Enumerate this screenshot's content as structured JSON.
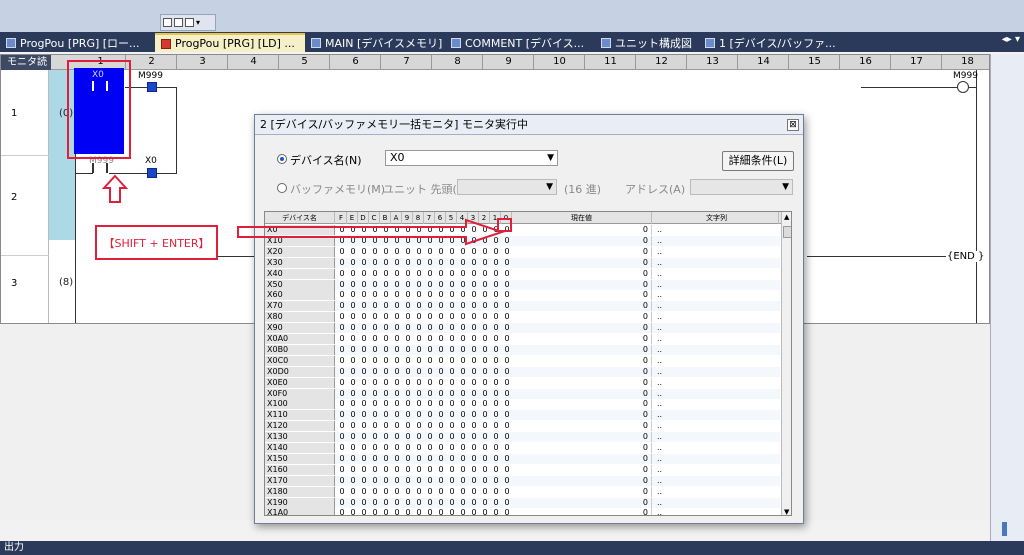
{
  "tabs": [
    {
      "label": "ProgPou [PRG] [ロー...",
      "active": false
    },
    {
      "label": "ProgPou [PRG] [LD] ...",
      "active": true
    },
    {
      "label": "MAIN [デバイスメモリ]",
      "active": false
    },
    {
      "label": "COMMENT [デバイス...",
      "active": false
    },
    {
      "label": "ユニット構成図",
      "active": false
    },
    {
      "label": "1 [デバイス/バッファ...",
      "active": false
    }
  ],
  "tab_controls": "◂▸ ▾",
  "ladder": {
    "mode_label": "モニタ読",
    "columns": [
      "1",
      "2",
      "3",
      "4",
      "5",
      "6",
      "7",
      "8",
      "9",
      "10",
      "11",
      "12",
      "13",
      "14",
      "15",
      "16",
      "17",
      "18"
    ],
    "rows": [
      {
        "num": "1",
        "step": "(0)"
      },
      {
        "num": "2",
        "step": ""
      },
      {
        "num": "3",
        "step": "(8)"
      }
    ],
    "devices": {
      "x0_contact": "X0",
      "m999_coil": "M999",
      "m999_contact": "M999",
      "x0_coil": "X0",
      "m999_out": "M999"
    },
    "end_label": "{END }"
  },
  "annotation": {
    "shift_enter": "【SHIFT + ENTER】"
  },
  "dialog": {
    "title": "2 [デバイス/バッファメモリ一括モニタ] モニタ実行中",
    "close": "⊠",
    "device_radio": "デバイス名(N)",
    "device_value": "X0",
    "buffer_radio": "バッファメモリ(M)",
    "unit_label": "ユニット 先頭(U)",
    "hex_label": "(16 進)",
    "address_label": "アドレス(A)",
    "detail_button": "詳細条件(L)",
    "grid_headers": {
      "name": "デバイス名",
      "bits": [
        "F",
        "E",
        "D",
        "C",
        "B",
        "A",
        "9",
        "8",
        "7",
        "6",
        "5",
        "4",
        "3",
        "2",
        "1",
        "0"
      ],
      "value": "現在値",
      "string": "文字列"
    },
    "rows": [
      "X0",
      "X10",
      "X20",
      "X30",
      "X40",
      "X50",
      "X60",
      "X70",
      "X80",
      "X90",
      "X0A0",
      "X0B0",
      "X0C0",
      "X0D0",
      "X0E0",
      "X0F0",
      "X100",
      "X110",
      "X120",
      "X130",
      "X140",
      "X150",
      "X160",
      "X170",
      "X180",
      "X190",
      "X1A0"
    ],
    "bit_value": "0",
    "current_value": "0",
    "string_value": ".."
  },
  "status_text": "出力",
  "colors": {
    "accent_red": "#e0203a",
    "selected_blue": "#0000f5",
    "tab_bar": "#2b3a5a"
  }
}
